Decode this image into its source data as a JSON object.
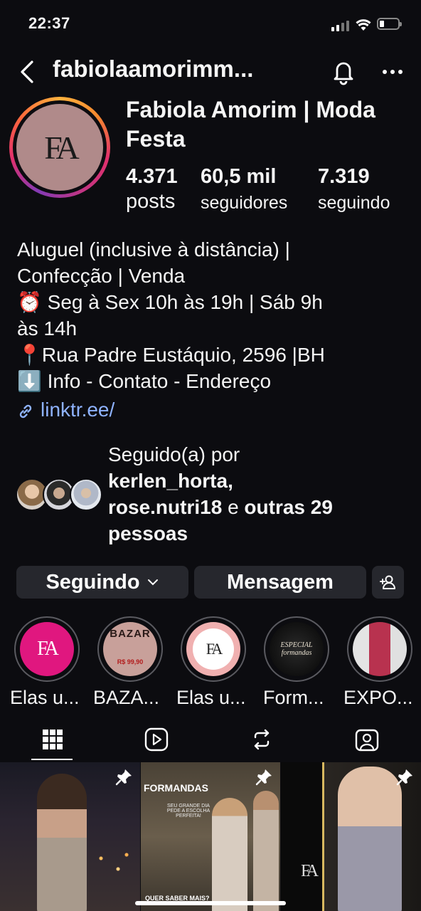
{
  "status_bar": {
    "time": "22:37"
  },
  "header": {
    "username": "fabiolaamorimm..."
  },
  "profile": {
    "avatar_text": "FA",
    "name": "Fabiola Amorim | Moda Festa",
    "stats": {
      "posts": {
        "value": "4.371",
        "label": "posts"
      },
      "followers": {
        "value": "60,5 mil",
        "label": "seguidores"
      },
      "following": {
        "value": "7.319",
        "label": "seguindo"
      }
    },
    "bio": [
      "Aluguel (inclusive à distância) |",
      "Confecção | Venda",
      "⏰ Seg à Sex 10h às 19h | Sáb 9h",
      "às 14h",
      "📍Rua Padre Eustáquio, 2596 |BH",
      "⬇️ Info - Contato - Endereço"
    ],
    "link": "linktr.ee/"
  },
  "followed_by": {
    "prefix": "Seguido(a) por",
    "user1": "kerlen_horta,",
    "user2": "rose.nutri18",
    "connector": "e",
    "others": "outras 29",
    "others2": "pessoas"
  },
  "actions": {
    "following_label": "Seguindo",
    "message_label": "Mensagem"
  },
  "highlights": [
    {
      "label": "Elas u...",
      "inner": "FA",
      "bg": "#e0177f"
    },
    {
      "label": "BAZA...",
      "inner": "BAZAR",
      "bg": "#c8a09a",
      "price": "R$ 99,90"
    },
    {
      "label": "Elas u...",
      "inner": "FA",
      "bg": "#f0b0b0"
    },
    {
      "label": "Form...",
      "inner": "ESPECIAL formandas",
      "bg": "#111111"
    },
    {
      "label": "EXPO...",
      "inner": "",
      "bg": "#d8d8d8"
    }
  ],
  "grid": [
    {
      "pinned": true
    },
    {
      "pinned": true,
      "title": "FORMANDAS",
      "subtitle": "SEU GRANDE DIA PEDE A ESCOLHA PERFEITA!",
      "footer": "QUER SABER MAIS?"
    },
    {
      "pinned": true,
      "logo": "FA"
    }
  ],
  "colors": {
    "link": "#8fb3ff",
    "button_bg": "#26272d",
    "background": "#0c0c10"
  }
}
